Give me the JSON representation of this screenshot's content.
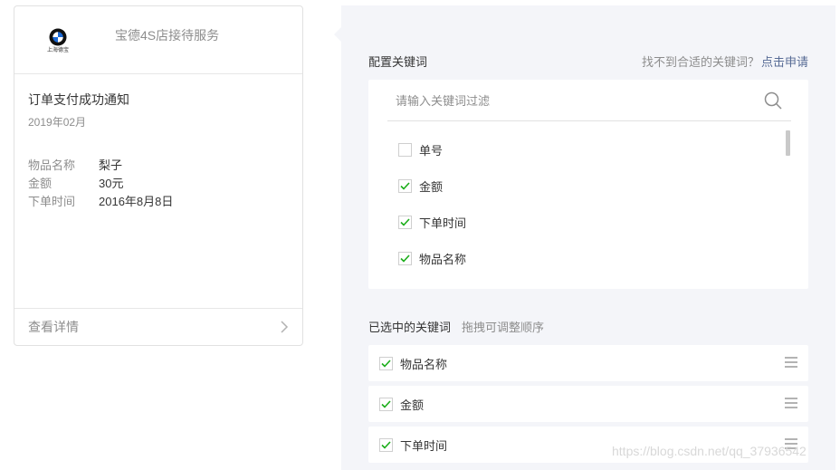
{
  "card": {
    "brand_name": "宝德4S店接待服务",
    "logo_caption": "上海德宝",
    "title": "订单支付成功通知",
    "date": "2019年02月",
    "fields": [
      {
        "key": "物品名称",
        "value": "梨子"
      },
      {
        "key": "金额",
        "value": "30元"
      },
      {
        "key": "下单时间",
        "value": "2016年8月8日"
      }
    ],
    "footer_link": "查看详情"
  },
  "keywords": {
    "heading": "配置关键词",
    "tip": "找不到合适的关键词？",
    "apply_link": "点击申请",
    "search_placeholder": "请输入关键词过滤",
    "options": [
      {
        "label": "单号",
        "checked": false
      },
      {
        "label": "金额",
        "checked": true
      },
      {
        "label": "下单时间",
        "checked": true
      },
      {
        "label": "物品名称",
        "checked": true
      }
    ]
  },
  "selected": {
    "heading": "已选中的关键词",
    "hint": "拖拽可调整顺序",
    "items": [
      {
        "label": "物品名称",
        "checked": true
      },
      {
        "label": "金额",
        "checked": true
      },
      {
        "label": "下单时间",
        "checked": true
      }
    ]
  },
  "watermark": "https://blog.csdn.net/qq_37936542",
  "colors": {
    "accent": "#1aad19",
    "link": "#576b95",
    "panel_bg": "#f4f5f9"
  }
}
